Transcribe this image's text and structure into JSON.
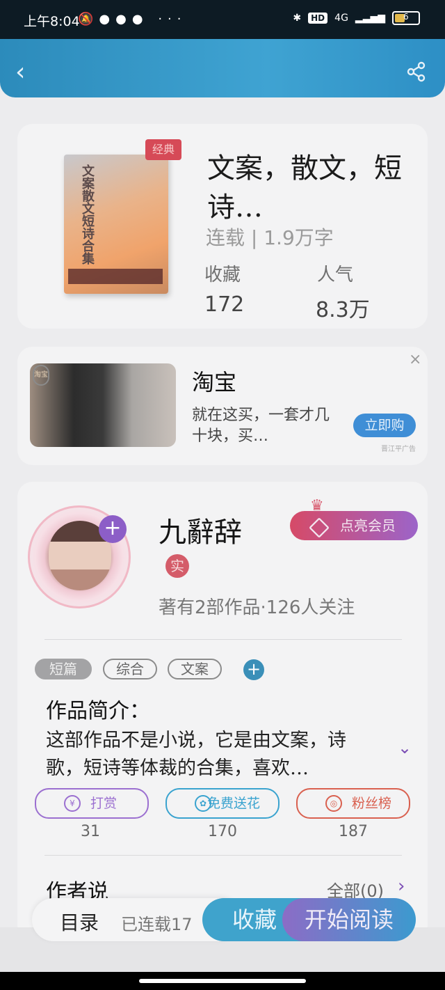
{
  "status_bar": {
    "time": "上午8:04",
    "dots": "···",
    "hd_label": "HD",
    "network": "4G",
    "battery": "6"
  },
  "header": {
    "back_icon": "chevron-left-icon",
    "share_icon": "share-icon"
  },
  "book": {
    "cover_title": "文案散文短诗合集",
    "badge": "经典",
    "title": "文案，散文，短诗…",
    "status": "连载 | 1.9万字",
    "stats": [
      {
        "label": "收藏",
        "value": "172"
      },
      {
        "label": "人气",
        "value": "8.3万"
      }
    ]
  },
  "ad": {
    "tag": "淘宝",
    "title": "淘宝",
    "description": "就在这买，一套才几十块，买…",
    "button": "立即购",
    "note": "晋江平广告",
    "close": "×"
  },
  "author": {
    "name": "九辭辞",
    "vip_button": "点亮会员",
    "real_badge": "实",
    "stats": "著有2部作品·126人关注",
    "tags": [
      "短篇",
      "综合",
      "文案"
    ],
    "intro_heading": "作品简介：",
    "intro_text": "这部作品不是小说，它是由文案，诗歌，短诗等体裁的合集，喜欢…",
    "actions": [
      {
        "label": "打赏",
        "count": "31",
        "color": "#9b6fd0"
      },
      {
        "label": "免费送花",
        "count": "170",
        "color": "#3aa3cf"
      },
      {
        "label": "粉丝榜",
        "count": "187",
        "color": "#d9604f"
      }
    ],
    "author_says": "作者说",
    "all_label": "全部(0)"
  },
  "bottom": {
    "catalog": "目录",
    "catalog_status": "已连载17",
    "collect": "收藏",
    "read": "开始阅读"
  }
}
